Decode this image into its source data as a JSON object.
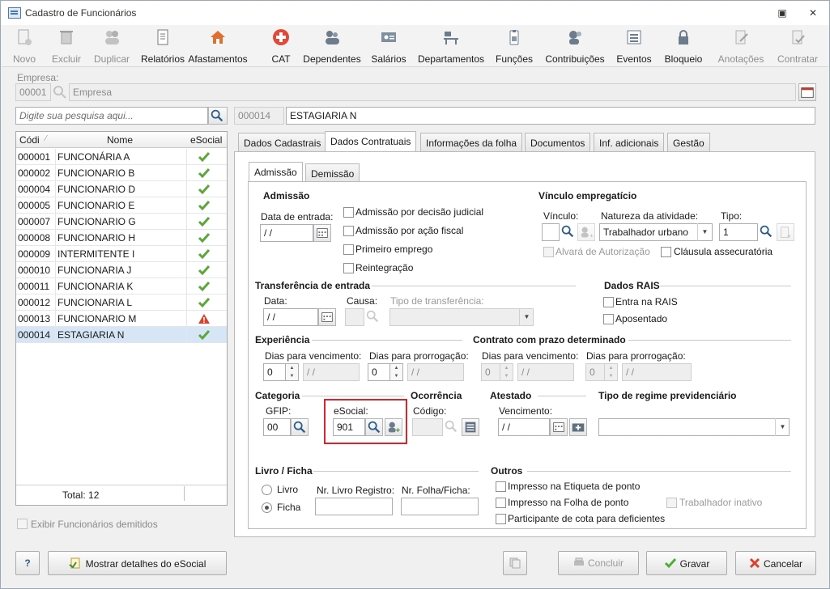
{
  "window": {
    "title": "Cadastro de Funcionários"
  },
  "toolbar": [
    {
      "label": "Novo",
      "enabled": false
    },
    {
      "label": "Excluir",
      "enabled": false
    },
    {
      "label": "Duplicar",
      "enabled": false
    },
    {
      "label": "Relatórios",
      "enabled": true
    },
    {
      "label": "Afastamentos",
      "enabled": true
    },
    {
      "label": "CAT",
      "enabled": true
    },
    {
      "label": "Dependentes",
      "enabled": true
    },
    {
      "label": "Salários",
      "enabled": true
    },
    {
      "label": "Departamentos",
      "enabled": true
    },
    {
      "label": "Funções",
      "enabled": true
    },
    {
      "label": "Contribuições",
      "enabled": true
    },
    {
      "label": "Eventos",
      "enabled": true
    },
    {
      "label": "Bloqueio",
      "enabled": true
    },
    {
      "label": "Anotações",
      "enabled": false
    },
    {
      "label": "Contratar",
      "enabled": false
    }
  ],
  "empresa": {
    "label": "Empresa:",
    "code": "00001",
    "name": "Empresa"
  },
  "search": {
    "placeholder": "Digite sua pesquisa aqui..."
  },
  "current": {
    "code": "000014",
    "name": "ESTAGIARIA N"
  },
  "grid": {
    "headers": {
      "code": "Códi",
      "name": "Nome",
      "esocial": "eSocial"
    },
    "rows": [
      {
        "code": "000001",
        "name": "FUNCONÁRIA A",
        "status": "ok"
      },
      {
        "code": "000002",
        "name": "FUNCIONARIO B",
        "status": "ok"
      },
      {
        "code": "000004",
        "name": "FUNCIONARIO D",
        "status": "ok"
      },
      {
        "code": "000005",
        "name": "FUNCIONARIO E",
        "status": "ok"
      },
      {
        "code": "000007",
        "name": "FUNCIONARIO G",
        "status": "ok"
      },
      {
        "code": "000008",
        "name": "FUNCIONARIO H",
        "status": "ok"
      },
      {
        "code": "000009",
        "name": "INTERMITENTE I",
        "status": "ok"
      },
      {
        "code": "000010",
        "name": "FUNCIONARIA J",
        "status": "ok"
      },
      {
        "code": "000011",
        "name": "FUNCIONARIA K",
        "status": "ok"
      },
      {
        "code": "000012",
        "name": "FUNCIONARIA L",
        "status": "ok"
      },
      {
        "code": "000013",
        "name": "FUNCIONARIO M",
        "status": "warning"
      },
      {
        "code": "000014",
        "name": "ESTAGIARIA N",
        "status": "ok"
      }
    ],
    "total": "Total: 12"
  },
  "show_dismissed": "Exibir Funcionários demitidos",
  "tabs": [
    "Dados Cadastrais",
    "Dados Contratuais",
    "Informações da folha",
    "Documentos",
    "Inf. adicionais",
    "Gestão"
  ],
  "active_tab": "Dados Contratuais",
  "subtabs": [
    "Admissão",
    "Demissão"
  ],
  "admissao": {
    "title": "Admissão",
    "data_entrada_label": "Data de entrada:",
    "data_entrada": " / /",
    "checks": [
      "Admissão por decisão judicial",
      "Admissão por ação fiscal",
      "Primeiro emprego",
      "Reintegração"
    ]
  },
  "vinculo": {
    "title": "Vínculo empregatício",
    "vinculo_label": "Vínculo:",
    "natureza_label": "Natureza da atividade:",
    "natureza": "Trabalhador urbano",
    "tipo_label": "Tipo:",
    "tipo": "1",
    "alvara": "Alvará de Autorização",
    "clausula": "Cláusula assecuratória"
  },
  "transferencia": {
    "title": "Transferência de entrada",
    "data_label": "Data:",
    "data": " / /",
    "causa_label": "Causa:",
    "tipo_label": "Tipo de transferência:"
  },
  "rais": {
    "title": "Dados RAIS",
    "entra": "Entra na RAIS",
    "aposentado": "Aposentado"
  },
  "experiencia": {
    "title": "Experiência",
    "venc_label": "Dias para vencimento:",
    "prorr_label": "Dias para prorrogação:",
    "venc": "0",
    "venc_date": " / /",
    "prorr": "0",
    "prorr_date": " / /"
  },
  "contrato": {
    "title": "Contrato com prazo determinado",
    "venc_label": "Dias para vencimento:",
    "prorr_label": "Dias para prorrogação:",
    "venc": "0",
    "venc_date": " / /",
    "prorr": "0",
    "prorr_date": " / /"
  },
  "categoria": {
    "title": "Categoria",
    "gfip_label": "GFIP:",
    "gfip": "00",
    "esocial_label": "eSocial:",
    "esocial": "901"
  },
  "ocorrencia": {
    "title": "Ocorrência",
    "codigo_label": "Código:"
  },
  "atestado": {
    "title": "Atestado",
    "venc_label": "Vencimento:",
    "venc": " / /"
  },
  "regime": {
    "title": "Tipo de regime previdenciário"
  },
  "livro": {
    "title": "Livro / Ficha",
    "livro": "Livro",
    "ficha": "Ficha",
    "registro_label": "Nr. Livro Registro:",
    "folha_label": "Nr. Folha/Ficha:"
  },
  "outros": {
    "title": "Outros",
    "etiqueta": "Impresso na Etiqueta de ponto",
    "folha": "Impresso na Folha de ponto",
    "inativo": "Trabalhador inativo",
    "cota": "Participante de cota para deficientes"
  },
  "footer": {
    "help": "?",
    "esocial_details": "Mostrar detalhes do eSocial",
    "concluir": "Concluir",
    "gravar": "Gravar",
    "cancelar": "Cancelar"
  }
}
